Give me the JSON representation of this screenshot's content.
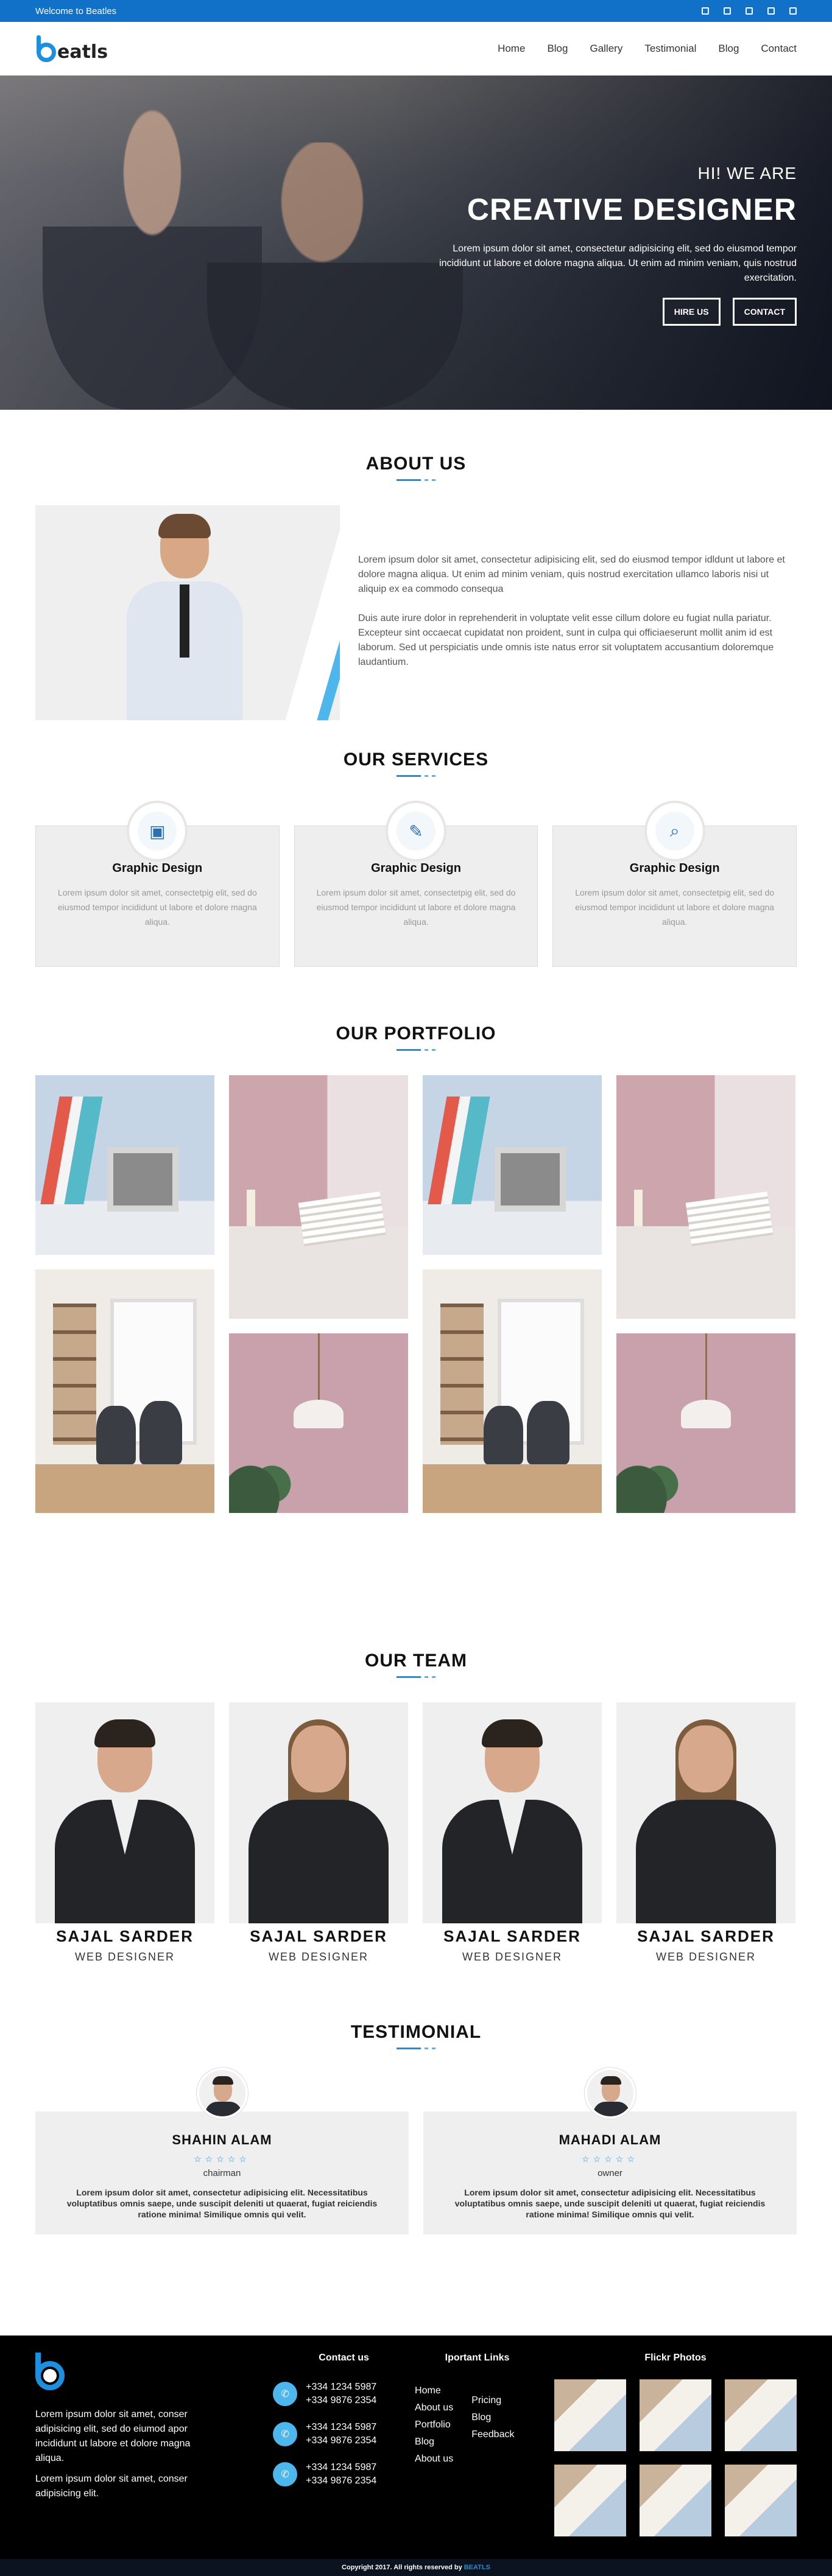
{
  "topbar": {
    "welcome": "Welcome to Beatles",
    "social_icons": [
      "facebook-icon",
      "twitter-icon",
      "google-plus-icon",
      "linkedin-icon",
      "pinterest-icon"
    ]
  },
  "nav": {
    "logo_text": "eatls",
    "menu": [
      "Home",
      "Blog",
      "Gallery",
      "Testimonial",
      "Blog",
      "Contact"
    ]
  },
  "hero": {
    "kicker": "HI! WE ARE",
    "title": "CREATIVE DESIGNER",
    "text": "Lorem ipsum dolor sit amet, consectetur adipisicing elit, sed do eiusmod tempor incididunt ut labore et dolore magna aliqua. Ut enim ad minim veniam, quis nostrud exercitation.",
    "btn_hire": "HIRE US",
    "btn_contact": "CONTACT"
  },
  "about": {
    "title": "ABOUT US",
    "p1": "Lorem ipsum dolor sit amet, consectetur adipisicing elit, sed do eiusmod tempor idldunt ut labore et dolore magna aliqua. Ut enim ad minim veniam, quis nostrud exercitation ullamco laboris nisi ut aliquip ex ea commodo consequa",
    "p2": "Duis aute irure dolor in reprehenderit in voluptate velit esse cillum dolore eu fugiat nulla pariatur. Excepteur sint occaecat cupidatat non proident, sunt in culpa qui officiaeserunt mollit anim id est laborum. Sed ut perspiciatis unde omnis iste natus error sit voluptatem accusantium doloremque laudantium."
  },
  "services": {
    "title": "OUR SERVICES",
    "items": [
      {
        "title": "Graphic Design",
        "icon": "monitor-icon",
        "text": "Lorem ipsum dolor sit amet, consectetpig elit, sed do eiusmod tempor incididunt ut labore et dolore magna aliqua."
      },
      {
        "title": "Graphic Design",
        "icon": "pen-tool-icon",
        "text": "Lorem ipsum dolor sit amet, consectetpig elit, sed do eiusmod tempor incididunt ut labore et dolore magna aliqua."
      },
      {
        "title": "Graphic Design",
        "icon": "search-icon",
        "text": "Lorem ipsum dolor sit amet, consectetpig elit, sed do eiusmod tempor incididunt ut labore et dolore magna aliqua."
      }
    ]
  },
  "portfolio": {
    "title": "OUR PORTFOLIO"
  },
  "team": {
    "title": "OUR TEAM",
    "members": [
      {
        "name": "SAJAL SARDER",
        "role": "WEB DESIGNER"
      },
      {
        "name": "SAJAL SARDER",
        "role": "WEB DESIGNER"
      },
      {
        "name": "SAJAL SARDER",
        "role": "WEB DESIGNER"
      },
      {
        "name": "SAJAL SARDER",
        "role": "WEB DESIGNER"
      }
    ]
  },
  "testimonial": {
    "title": "TESTIMONIAL",
    "items": [
      {
        "name": "SHAHIN ALAM",
        "stars": "☆☆☆☆☆",
        "position": "chairman",
        "text": "Lorem ipsum dolor sit amet, consectetur adipisicing elit. Necessitatibus voluptatibus omnis saepe, unde suscipit deleniti ut quaerat, fugiat reiciendis ratione minima! Similique omnis qui velit."
      },
      {
        "name": "MAHADI ALAM",
        "stars": "☆☆☆☆☆",
        "position": "owner",
        "text": "Lorem ipsum dolor sit amet, consectetur adipisicing elit. Necessitatibus voluptatibus omnis saepe, unde suscipit deleniti ut quaerat, fugiat reiciendis ratione minima! Similique omnis qui velit."
      }
    ]
  },
  "footer": {
    "about_p1": "Lorem ipsum dolor sit amet, conser adipisicing elit, sed do eiumod apor incididunt ut labore et dolore magna aliqua.",
    "about_p2": "Lorem ipsum dolor sit amet, conser adipisicing elit.",
    "contact_title": "Contact us",
    "contacts": [
      {
        "phone1": "+334 1234 5987",
        "phone2": "+334 9876 2354"
      },
      {
        "phone1": "+334 1234 5987",
        "phone2": "+334 9876 2354"
      },
      {
        "phone1": "+334 1234 5987",
        "phone2": "+334 9876 2354"
      }
    ],
    "links_title": "Iportant Links",
    "links_a": [
      "Home",
      "About us",
      "Portfolio",
      "Blog",
      "About us"
    ],
    "links_b": [
      "Pricing",
      "Blog",
      "Feedback"
    ],
    "flickr_title": "Flickr Photos",
    "copyright": "Copyright   2017. All rights reserved by",
    "copyright_brand": "BEATLS"
  },
  "colors": {
    "primary": "#1170c8",
    "accent": "#1c8fdf",
    "light_accent": "#4db6ec",
    "footer_bg": "#000000"
  }
}
